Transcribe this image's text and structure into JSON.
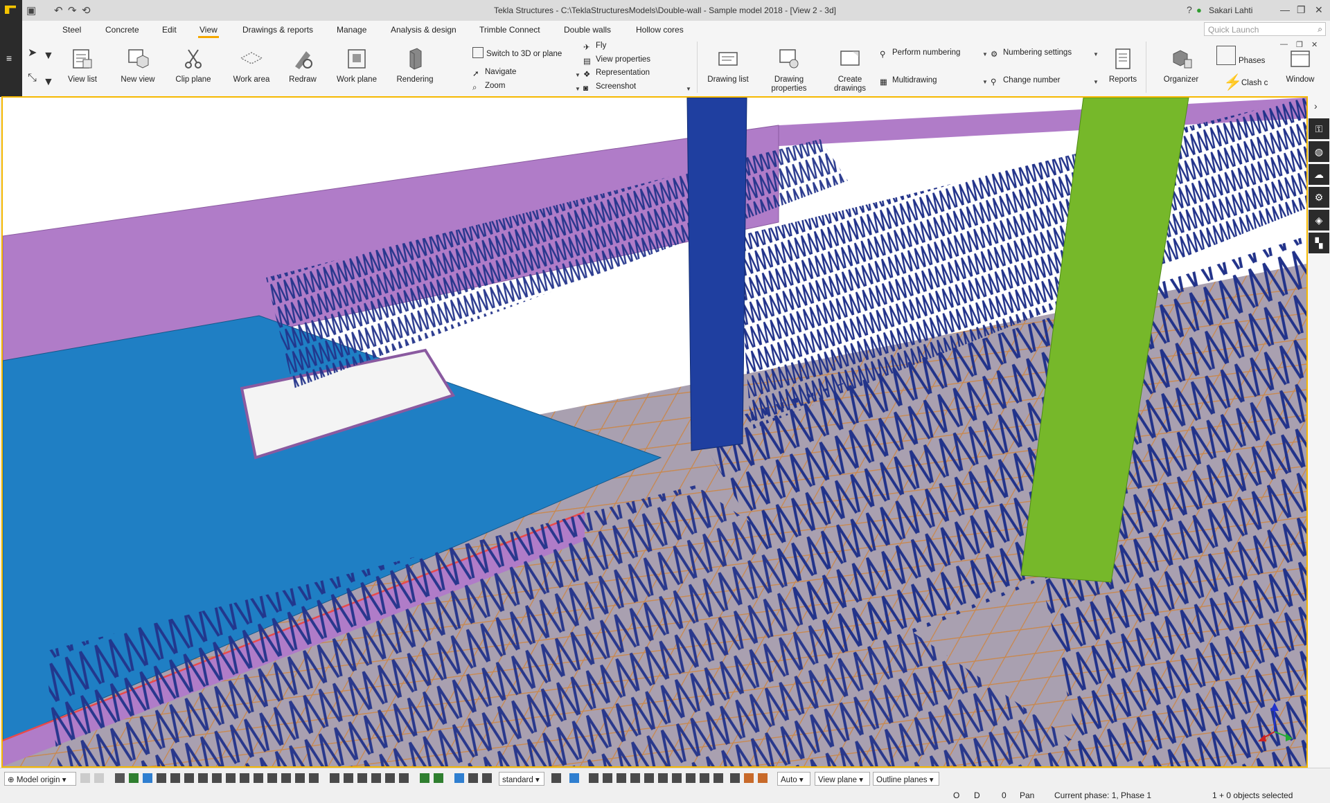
{
  "window": {
    "title": "Tekla Structures - C:\\TeklaStructuresModels\\Double-wall - Sample model 2018 - [View 2 - 3d]",
    "user": "Sakari Lahti",
    "help": "?",
    "minimize": "—",
    "restore": "❐",
    "close": "✕"
  },
  "tabs": [
    "Steel",
    "Concrete",
    "Edit",
    "View",
    "Drawings & reports",
    "Manage",
    "Analysis & design",
    "Trimble Connect",
    "Double walls",
    "Hollow cores"
  ],
  "active_tab": "View",
  "quick_launch": {
    "placeholder": "Quick Launch"
  },
  "ribbon": {
    "view_list": "View list",
    "new_view": "New view",
    "clip_plane": "Clip plane",
    "work_area": "Work area",
    "redraw": "Redraw",
    "work_plane": "Work plane",
    "rendering": "Rendering",
    "switch_3d": "Switch to 3D or plane",
    "navigate": "Navigate",
    "zoom": "Zoom",
    "fly": "Fly",
    "view_properties": "View properties",
    "representation": "Representation",
    "screenshot": "Screenshot",
    "drawing_list": "Drawing list",
    "drawing_properties_1": "Drawing",
    "drawing_properties_2": "properties",
    "create_drawings_1": "Create",
    "create_drawings_2": "drawings",
    "perform_numbering": "Perform numbering",
    "multidrawing": "Multidrawing",
    "numbering_settings": "Numbering settings",
    "change_number": "Change number",
    "reports": "Reports",
    "organizer": "Organizer",
    "phases": "Phases",
    "clash": "Clash c",
    "window": "Window"
  },
  "statusbar": {
    "model_origin": "Model origin",
    "standard": "standard",
    "auto": "Auto",
    "view_plane": "View plane",
    "outline_planes": "Outline planes"
  },
  "info": {
    "o": "O",
    "d": "D",
    "zero": "0",
    "pan": "Pan",
    "phase": "Current phase: 1, Phase 1",
    "selected": "1 + 0 objects selected"
  },
  "colors": {
    "accent": "#f5b800",
    "wall_blue": "#1f7fc4",
    "wall_purple": "#b07cc8",
    "rebar": "#22338a",
    "column_green": "#76b82a",
    "column_blue": "#1f3fa0",
    "mesh": "#c88a5a"
  }
}
